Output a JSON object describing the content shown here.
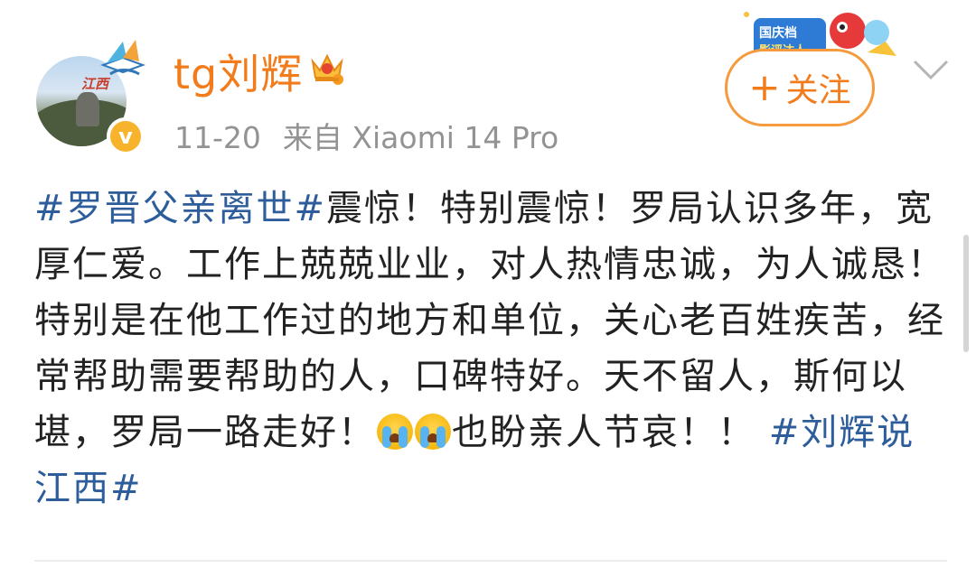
{
  "header": {
    "username": "tg刘辉",
    "timestamp": "11-20",
    "source": "来自 Xiaomi 14 Pro",
    "avatar_text": "江西",
    "verified_icon": "verified-v-badge",
    "vip_icon": "crown-vip-icon",
    "event_badge_text": "国庆档 影评达人",
    "follow_button": {
      "plus": "+",
      "label": "关注"
    },
    "dropdown_icon": "chevron-down-icon"
  },
  "post": {
    "tag_1": "#罗晋父亲离世#",
    "text_1": "震惊！特别震惊！罗局认识多年，宽厚仁爱。工作上兢兢业业，对人热情忠诚，为人诚恳！特别是在他工作过的地方和单位，关心老百姓疾苦，经常帮助需要帮助的人，口碑特好。天不留人，斯何以堪，罗局一路走好！",
    "emoji_1": "crying-emoji",
    "emoji_2": "crying-emoji",
    "text_2": "也盼亲人节哀！！",
    "tag_2": "#刘辉说江西#"
  },
  "colors": {
    "username": "#f27c1c",
    "link": "#2d5d9a",
    "meta": "#939393",
    "follow_border": "#f59a3d"
  }
}
